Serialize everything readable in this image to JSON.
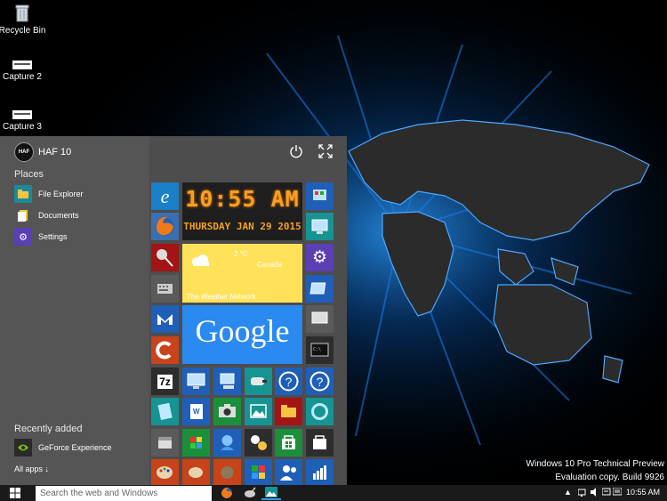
{
  "desktop": {
    "icons": [
      {
        "label": "Recycle Bin",
        "icon": "recycle-bin-icon"
      },
      {
        "label": "Capture 2",
        "icon": "image-file-icon"
      },
      {
        "label": "Capture 3",
        "icon": "image-file-icon"
      }
    ],
    "watermark": {
      "line1": "Windows 10 Pro Technical Preview",
      "line2": "Evaluation copy. Build 9926"
    }
  },
  "start_menu": {
    "user": {
      "avatar_text": "HAF",
      "name": "HAF 10"
    },
    "power_icon": "power-icon",
    "expand_icon": "expand-icon",
    "places_heading": "Places",
    "places": [
      {
        "label": "File Explorer",
        "icon": "folder-icon",
        "color": "#1a8b9c"
      },
      {
        "label": "Documents",
        "icon": "documents-icon",
        "color": "#555555"
      },
      {
        "label": "Settings",
        "icon": "gear-icon",
        "color": "#5a3fb5"
      }
    ],
    "recent_heading": "Recently added",
    "recent": [
      {
        "label": "GeForce Experience",
        "icon": "geforce-icon"
      }
    ],
    "all_apps": "All apps ↓",
    "tiles": {
      "clock": {
        "time": "10:55 AM",
        "date": "THURSDAY JAN 29 2015"
      },
      "weather": {
        "temp": "2 °C",
        "location": "Canada",
        "source": "The Weather Network"
      },
      "google": {
        "text": "Google"
      }
    },
    "tile_colors": {
      "ie": "#1b7fc7",
      "firefox": "#3a6fb0",
      "red": "#a31515",
      "grey": "#5a5a5a",
      "blue": "#1f5fb8",
      "teal": "#169393",
      "purple": "#5a3fb5",
      "green": "#1b8f3a",
      "orange": "#c8431a",
      "dark": "#2d2d2d"
    }
  },
  "taskbar": {
    "search_placeholder": "Search the web and Windows",
    "clock": "10:55 AM",
    "tray_up": "▲"
  }
}
